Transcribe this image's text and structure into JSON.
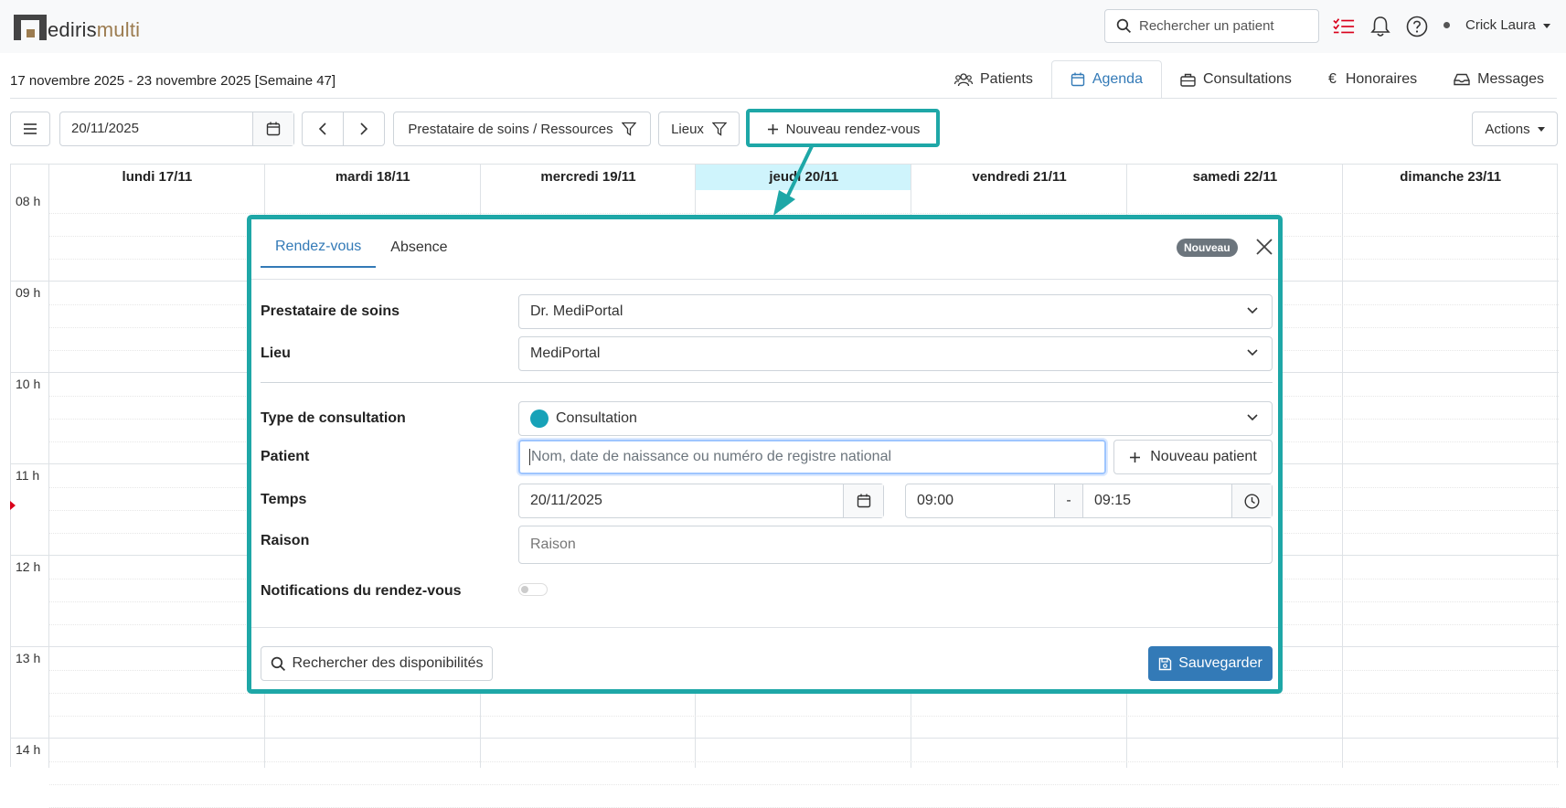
{
  "app": {
    "logo_a": "ediris",
    "logo_b": "multi"
  },
  "topbar": {
    "search_placeholder": "Rechercher un patient",
    "user_name": "Crick Laura"
  },
  "header": {
    "week_title": "17 novembre 2025 - 23 novembre 2025 [Semaine 47]",
    "tabs": [
      {
        "label": "Patients",
        "icon": "users-icon"
      },
      {
        "label": "Agenda",
        "icon": "calendar-icon",
        "active": true
      },
      {
        "label": "Consultations",
        "icon": "briefcase-icon"
      },
      {
        "label": "Honoraires",
        "icon": "euro-icon"
      },
      {
        "label": "Messages",
        "icon": "inbox-icon"
      }
    ]
  },
  "toolbar": {
    "date": "20/11/2025",
    "providers_filter": "Prestataire de soins / Ressources",
    "places_filter": "Lieux",
    "new_appointment": "Nouveau rendez-vous",
    "actions": "Actions"
  },
  "calendar": {
    "days": [
      "lundi 17/11",
      "mardi 18/11",
      "mercredi 19/11",
      "jeudi 20/11",
      "vendredi 21/11",
      "samedi 22/11",
      "dimanche 23/11"
    ],
    "today_index": 3,
    "hours": [
      "08 h",
      "09 h",
      "10 h",
      "11 h",
      "12 h",
      "13 h",
      "14 h"
    ]
  },
  "modal": {
    "tabs": [
      "Rendez-vous",
      "Absence"
    ],
    "badge": "Nouveau",
    "fields": {
      "provider_label": "Prestataire de soins",
      "provider_value": "Dr. MediPortal",
      "place_label": "Lieu",
      "place_value": "MediPortal",
      "type_label": "Type de consultation",
      "type_value": "Consultation",
      "type_color": "#17a2b8",
      "patient_label": "Patient",
      "patient_placeholder": "Nom, date de naissance ou numéro de registre national",
      "new_patient": "Nouveau patient",
      "time_label": "Temps",
      "time_date": "20/11/2025",
      "time_from": "09:00",
      "time_sep": "-",
      "time_to": "09:15",
      "reason_label": "Raison",
      "reason_placeholder": "Raison",
      "notifications_label": "Notifications du rendez-vous"
    },
    "search_availability": "Rechercher des disponibilités",
    "save": "Sauvegarder"
  },
  "colors": {
    "accent": "#337ab7",
    "highlight": "#1ea7a7",
    "today": "#cff4fc"
  }
}
